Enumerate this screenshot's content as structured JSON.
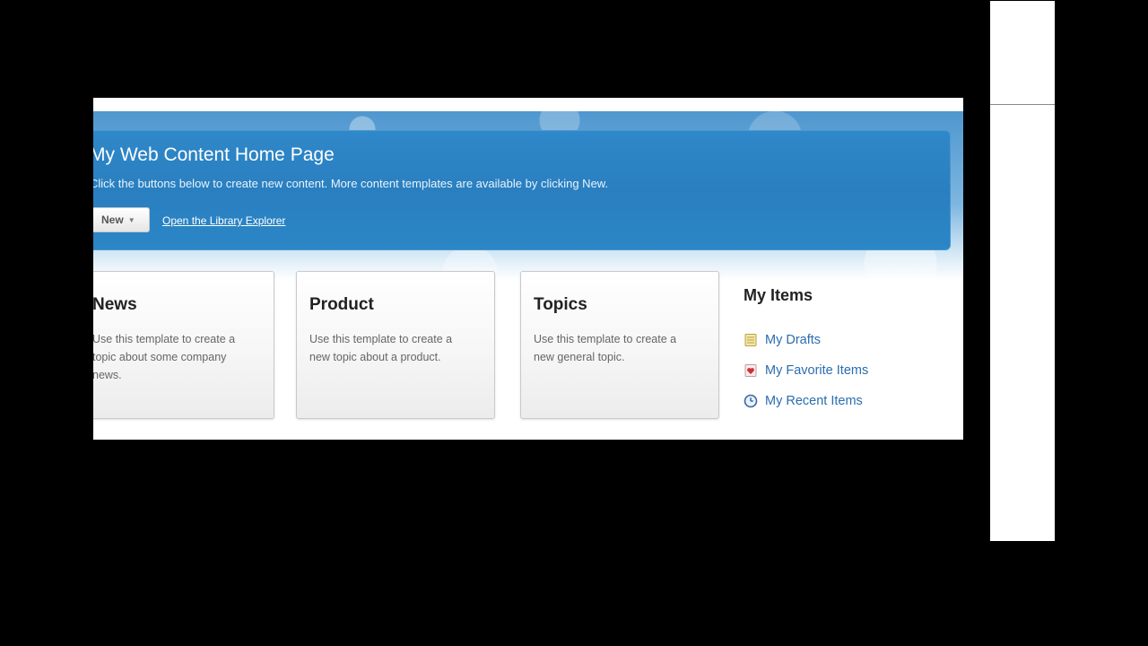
{
  "banner": {
    "title": "My Web Content Home Page",
    "subtitle": "Click the buttons below to create new content. More content templates are available by clicking New.",
    "new_button": "New",
    "library_link": "Open the Library Explorer"
  },
  "tiles": [
    {
      "title": "News",
      "description": "Use this template to create a topic about some company news."
    },
    {
      "title": "Product",
      "description": "Use this template to create a new topic about a product."
    },
    {
      "title": "Topics",
      "description": "Use this template to create a new general topic."
    }
  ],
  "my_items": {
    "title": "My Items",
    "items": [
      {
        "label": "My Drafts",
        "icon": "drafts-notepad-icon"
      },
      {
        "label": "My Favorite Items",
        "icon": "favorite-heart-icon"
      },
      {
        "label": "My Recent Items",
        "icon": "recent-clock-icon"
      }
    ]
  },
  "colors": {
    "banner_blue": "#2a7fc0",
    "link_blue": "#2a6db0",
    "page_background": "#000000"
  }
}
